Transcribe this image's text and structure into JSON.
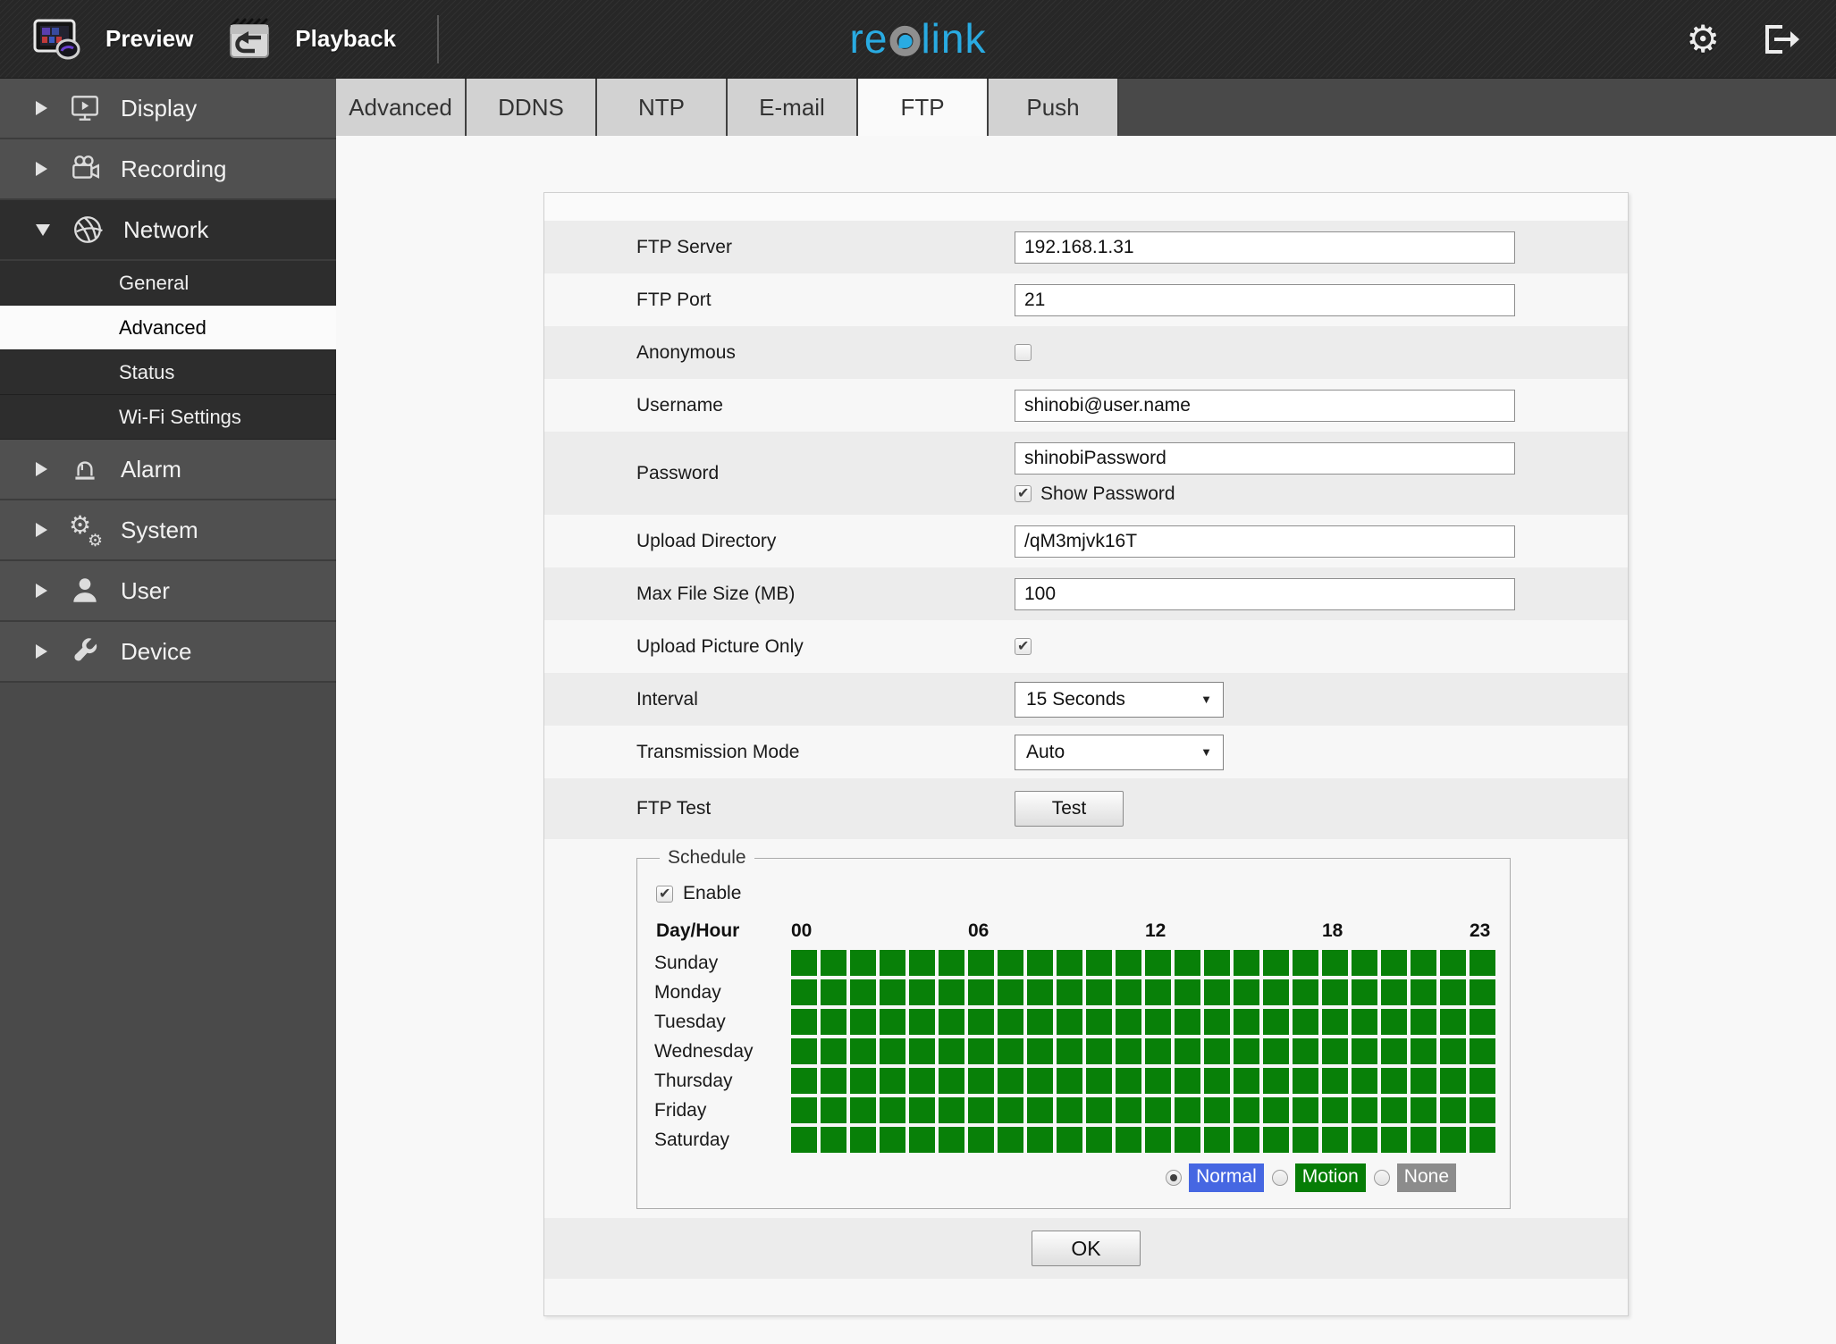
{
  "header": {
    "preview_label": "Preview",
    "playback_label": "Playback",
    "logo": {
      "part1": "re",
      "part2": "link"
    }
  },
  "tabs": [
    {
      "label": "Advanced",
      "active": false
    },
    {
      "label": "DDNS",
      "active": false
    },
    {
      "label": "NTP",
      "active": false
    },
    {
      "label": "E-mail",
      "active": false
    },
    {
      "label": "FTP",
      "active": true
    },
    {
      "label": "Push",
      "active": false
    }
  ],
  "sidebar": {
    "items": [
      {
        "label": "Display",
        "expanded": false
      },
      {
        "label": "Recording",
        "expanded": false
      },
      {
        "label": "Network",
        "expanded": true,
        "children": [
          {
            "label": "General",
            "selected": false
          },
          {
            "label": "Advanced",
            "selected": true
          },
          {
            "label": "Status",
            "selected": false
          },
          {
            "label": "Wi-Fi Settings",
            "selected": false
          }
        ]
      },
      {
        "label": "Alarm",
        "expanded": false
      },
      {
        "label": "System",
        "expanded": false
      },
      {
        "label": "User",
        "expanded": false
      },
      {
        "label": "Device",
        "expanded": false
      }
    ]
  },
  "form": {
    "ftp_server": {
      "label": "FTP Server",
      "value": "192.168.1.31"
    },
    "ftp_port": {
      "label": "FTP Port",
      "value": "21"
    },
    "anonymous": {
      "label": "Anonymous",
      "checked": false
    },
    "username": {
      "label": "Username",
      "value": "shinobi@user.name"
    },
    "password": {
      "label": "Password",
      "value": "shinobiPassword",
      "show_password_label": "Show Password",
      "show_password_checked": true
    },
    "upload_directory": {
      "label": "Upload Directory",
      "value": "/qM3mjvk16T"
    },
    "max_file_size": {
      "label": "Max File Size (MB)",
      "value": "100"
    },
    "upload_picture_only": {
      "label": "Upload Picture Only",
      "checked": true
    },
    "interval": {
      "label": "Interval",
      "value": "15 Seconds"
    },
    "transmission_mode": {
      "label": "Transmission Mode",
      "value": "Auto"
    },
    "ftp_test": {
      "label": "FTP Test",
      "button_label": "Test"
    }
  },
  "schedule": {
    "title": "Schedule",
    "enable_label": "Enable",
    "enable_checked": true,
    "day_hour_label": "Day/Hour",
    "hour_labels": [
      {
        "text": "00",
        "col": 0
      },
      {
        "text": "06",
        "col": 6
      },
      {
        "text": "12",
        "col": 12
      },
      {
        "text": "18",
        "col": 18
      },
      {
        "text": "23",
        "col": 23
      }
    ],
    "days": [
      "Sunday",
      "Monday",
      "Tuesday",
      "Wednesday",
      "Thursday",
      "Friday",
      "Saturday"
    ],
    "columns": 24,
    "cell_state": "all-selected",
    "cell_color": "#088008",
    "modes": [
      {
        "label": "Normal",
        "color": "#4667e2",
        "selected": true
      },
      {
        "label": "Motion",
        "color": "#067d06",
        "selected": false
      },
      {
        "label": "None",
        "color": "#8c8c8c",
        "selected": false
      }
    ]
  },
  "ok_label": "OK"
}
